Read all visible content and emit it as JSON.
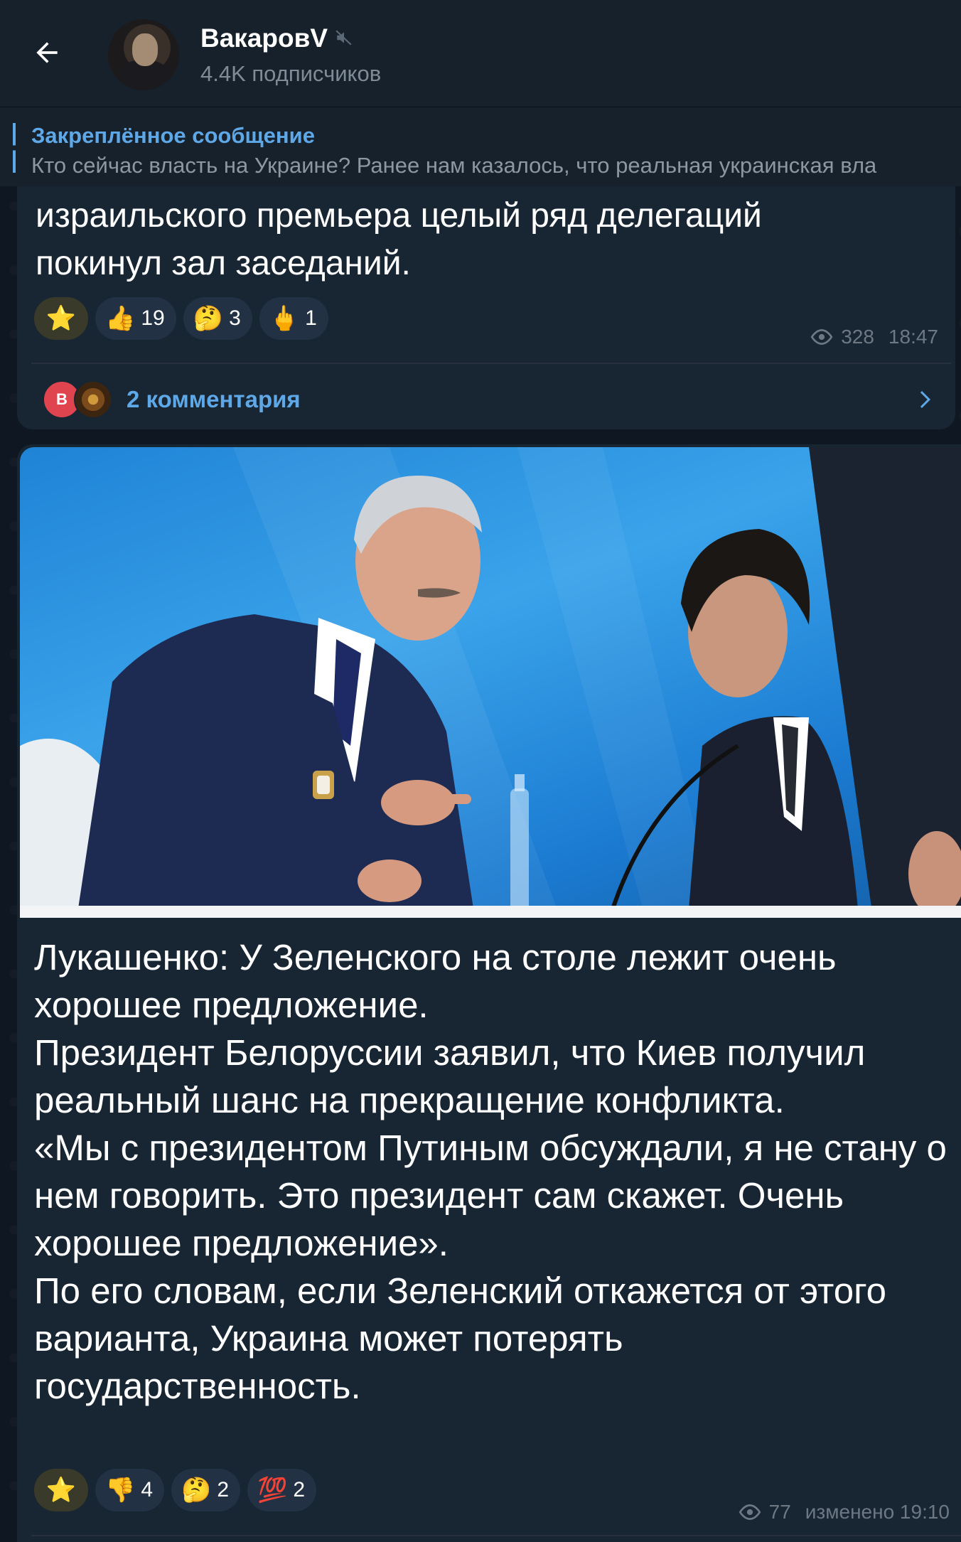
{
  "header": {
    "channel_name": "ВакаровV",
    "subscribers": "4.4K подписчиков"
  },
  "pinned": {
    "title": "Закреплённое сообщение",
    "text": "Кто сейчас власть на Украине? Ранее нам казалось, что реальная украинская вла"
  },
  "message1": {
    "text_lines": [
      "израильского премьера целый ряд делегаций",
      "покинул зал заседаний."
    ],
    "reactions": [
      {
        "emoji": "⭐",
        "count": ""
      },
      {
        "emoji": "👍",
        "count": "19"
      },
      {
        "emoji": "🤔",
        "count": "3"
      },
      {
        "emoji": "🖕",
        "count": "1"
      }
    ],
    "views": "328",
    "time": "18:47",
    "comments_label": "2 комментария",
    "commenter_initial": "В"
  },
  "message2": {
    "paragraphs": [
      "Лукашенко: У Зеленского на столе лежит очень хорошее предложение.",
      "Президент Белоруссии заявил, что Киев получил реальный шанс на прекращение конфликта.",
      "«Мы с президентом Путиным обсуждали, я не стану о нем говорить. Это президент сам скажет. Очень хорошее предложение».",
      "По его словам, если Зеленский откажется от этого варианта, Украина может потерять государственность."
    ],
    "reactions": [
      {
        "emoji": "⭐",
        "count": ""
      },
      {
        "emoji": "👎",
        "count": "4"
      },
      {
        "emoji": "🤔",
        "count": "2"
      },
      {
        "emoji": "💯",
        "count": "2"
      }
    ],
    "views": "77",
    "edited_label": "изменено 19:10"
  },
  "colors": {
    "header_bg": "#17212b",
    "bubble_bg": "#182533",
    "accent": "#5fa8e8",
    "meta_text": "#6d7883"
  },
  "icons": [
    "back-arrow-icon",
    "mute-icon",
    "eye-icon",
    "chevron-right-icon"
  ]
}
